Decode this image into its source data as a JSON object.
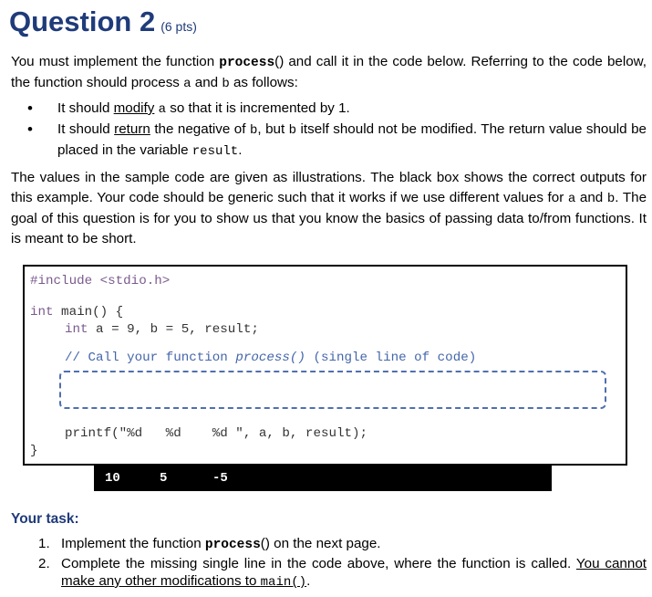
{
  "header": {
    "title": "Question 2",
    "points": "(6 pts)"
  },
  "intro": {
    "t1": "You must implement the function ",
    "fn": "process",
    "t2": "() and call it in the code below. Referring to the code below, the function should process ",
    "a": "a",
    "t3": " and ",
    "b": "b",
    "t4": " as follows:"
  },
  "bullets": [
    {
      "t1": "It should ",
      "u": "modify",
      "t2": " ",
      "code": "a",
      "t3": " so that it is incremented by 1."
    },
    {
      "t1": "It should ",
      "u": "return",
      "t2": " the negative of ",
      "code1": "b",
      "t3": ", but ",
      "code2": "b",
      "t4": " itself should not be modified. The return value should be placed in the variable ",
      "code3": "result",
      "t5": "."
    }
  ],
  "para2": {
    "t1": "The values in the sample code are given as illustrations. The black box shows the correct outputs for this example. Your code should be generic such that it works if we use different values for ",
    "a": "a",
    "t2": " and ",
    "b": "b",
    "t3": ". The goal of this question is for you to show us that you know the basics of passing data to/from functions. It is meant to be short."
  },
  "code": {
    "include": "#include <stdio.h>",
    "main_kw": "int",
    "main_rest": " main() {",
    "decl_kw": "int",
    "decl_rest": " a = 9, b = 5, result;",
    "comment1": "// Call your function ",
    "comment_fn": "process()",
    "comment2": " (single line of code)",
    "printf": "printf(\"%d   %d    %d \", a, b, result);",
    "close": "}"
  },
  "output": [
    "10",
    "5",
    "-5"
  ],
  "task": {
    "heading": "Your task:",
    "items": [
      {
        "num": "1.",
        "t1": "Implement the function ",
        "fn": "process",
        "t2": "() on the next page."
      },
      {
        "num": "2.",
        "t1": "Complete the missing single line in the code above, where the function is called. ",
        "u1": "You cannot make any other modifications to ",
        "code": "main()",
        "t2": "."
      }
    ]
  }
}
